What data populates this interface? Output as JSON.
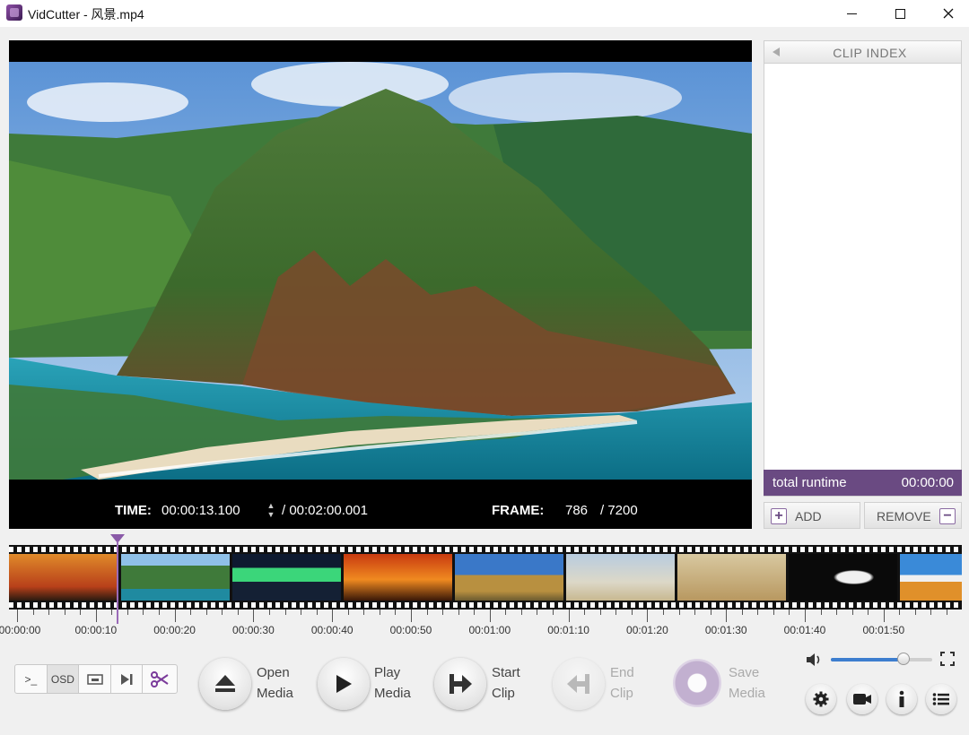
{
  "window": {
    "title": "VidCutter - 风景.mp4"
  },
  "video": {
    "time_label": "TIME:",
    "time_current": "00:00:13.100",
    "time_total": "/ 00:02:00.001",
    "frame_label": "FRAME:",
    "frame_current": "786",
    "frame_total": "/  7200"
  },
  "clip_index": {
    "title": "CLIP INDEX",
    "runtime_label": "total runtime",
    "runtime_value": "00:00:00",
    "add_label": "ADD",
    "remove_label": "REMOVE"
  },
  "timeline": {
    "playhead_fraction": 0.109,
    "tick_labels": [
      "00:00:00",
      "00:00:10",
      "00:00:20",
      "00:00:30",
      "00:00:40",
      "00:00:50",
      "00:01:00",
      "00:01:10",
      "00:01:20",
      "00:01:30",
      "00:01:40",
      "00:01:50"
    ]
  },
  "toolbar": {
    "console_label": ">_",
    "osd_label": "OSD",
    "open_label_1": "Open",
    "open_label_2": "Media",
    "play_label_1": "Play",
    "play_label_2": "Media",
    "start_label_1": "Start",
    "start_label_2": "Clip",
    "end_label_1": "End",
    "end_label_2": "Clip",
    "save_label_1": "Save",
    "save_label_2": "Media"
  },
  "volume": {
    "level_fraction": 0.72
  },
  "colors": {
    "accent": "#6a4a82",
    "volume_fill": "#3d7ecf"
  }
}
